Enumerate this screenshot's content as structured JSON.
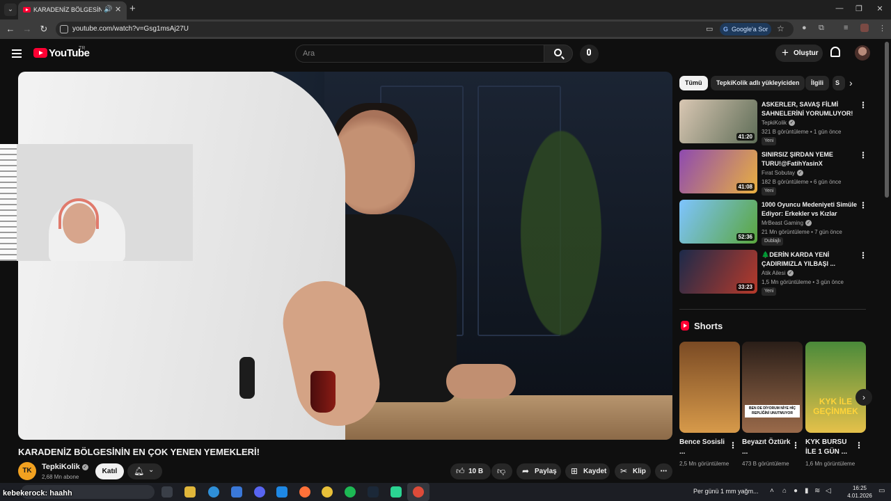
{
  "browser": {
    "tab_title": "KARADENİZ BÖLGESİNİN EN",
    "url": "youtube.com/watch?v=Gsg1msAj27U",
    "google_sor": "Google'a Sor"
  },
  "masthead": {
    "logo": "YouTube",
    "region": "TR",
    "search_placeholder": "Ara",
    "create": "Oluştur"
  },
  "video": {
    "title": "KARADENİZ BÖLGESİNİN EN ÇOK YENEN YEMEKLERİ!",
    "channel": {
      "name": "TepkiKolik",
      "avatar_text": "TK",
      "subs": "2,68 Mn abone"
    },
    "join": "Katıl",
    "likes": "10 B",
    "share": "Paylaş",
    "save": "Kaydet",
    "clip": "Klip"
  },
  "chips": [
    "Tümü",
    "TepkiKolik adlı yükleyiciden",
    "İlgili",
    "S"
  ],
  "recommendations": [
    {
      "title": "ASKERLER, SAVAŞ FİLMİ SAHNELERİNİ YORUMLUYOR!",
      "channel": "TepkiKolik",
      "meta": "321 B görüntüleme • 1 gün önce",
      "badge": "Yeni",
      "duration": "41:20",
      "colors": [
        "#d9c7b3",
        "#5e6d57"
      ]
    },
    {
      "title": "SINIRSIZ ŞIRDAN YEME TURU!@FatihYasinX",
      "channel": "Fırat Sobutay",
      "meta": "182 B görüntüleme • 6 gün önce",
      "badge": "Yeni",
      "duration": "41:08",
      "colors": [
        "#8e4ab0",
        "#e9b040"
      ]
    },
    {
      "title": "1000 Oyuncu Medeniyeti Simüle Ediyor: Erkekler vs Kızlar",
      "channel": "MrBeast Gaming",
      "meta": "21 Mn görüntüleme • 7 gün önce",
      "badge": "Dublajlı",
      "duration": "52:36",
      "colors": [
        "#7ec4ff",
        "#5aa63c"
      ]
    },
    {
      "title": "🌲DERİN KARDA YENİ ÇADIRIMIZLA YILBAŞI ...",
      "channel": "Atik Ailesi",
      "meta": "1,5 Mn görüntüleme • 3 gün önce",
      "badge": "Yeni",
      "duration": "33:23",
      "colors": [
        "#1c2a4a",
        "#b83a2a"
      ]
    }
  ],
  "shorts": {
    "heading": "Shorts",
    "items": [
      {
        "title": "Bence Sosisli ...",
        "views": "2,5 Mn görüntüleme",
        "colors": [
          "#7a4a24",
          "#d79a4a"
        ]
      },
      {
        "title": "Beyazıt Öztürk ...",
        "views": "473 B görüntüleme",
        "colors": [
          "#2a1e18",
          "#9a6a4a"
        ],
        "caption": "BEN DE DİYORUM NİYE HİÇ REPLİĞİNİ UNUTMUYOR"
      },
      {
        "title": "KYK BURSU İLE 1 GÜN ...",
        "views": "1,6 Mn görüntüleme",
        "colors": [
          "#4a8a3a",
          "#e5c14a"
        ],
        "caption": "KYK İLE GEÇİNMEK"
      }
    ]
  },
  "taskbar": {
    "chat_nick": "kebekerock",
    "chat_msg": ": haahh",
    "weather": "Per günü 1 mm yağm...",
    "time": "16:25",
    "date": "4.01.2026"
  }
}
